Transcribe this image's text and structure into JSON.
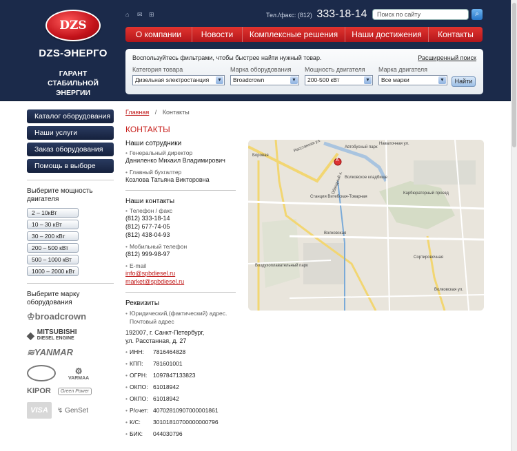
{
  "logo": {
    "mark": "DZS",
    "name": "DZS-ЭНЕРГО",
    "slogan_1": "ГАРАНТ СТАБИЛЬНОЙ",
    "slogan_2": "ЭНЕРГИИ"
  },
  "top_icons": [
    "home-icon",
    "mail-icon",
    "sitemap-icon"
  ],
  "phone": {
    "label": "Тел./факс: (812)",
    "number": "333-18-14"
  },
  "search": {
    "placeholder": "Поиск по сайту"
  },
  "nav": [
    "О компании",
    "Новости",
    "Комплексные решения",
    "Наши достижения",
    "Контакты"
  ],
  "filter": {
    "hint": "Воспользуйтесь фильтрами, чтобы быстрее найти нужный товар.",
    "advanced": "Расширенный поиск",
    "fields": [
      {
        "label": "Категория товара",
        "value": "Дизельная электростанция"
      },
      {
        "label": "Марка оборудования",
        "value": "Broadcrown"
      },
      {
        "label": "Мощность двигателя",
        "value": "200-500 кВт"
      },
      {
        "label": "Марка двигателя",
        "value": "Все марки"
      }
    ],
    "button": "Найти"
  },
  "sidebar": {
    "menu": [
      "Каталог оборудования",
      "Наши услуги",
      "Заказ оборудования",
      "Помощь в выборе"
    ],
    "power_title": "Выберите мощность двигателя",
    "power": [
      "2 – 10кВт",
      "10 – 30 кВт",
      "30 – 200 кВт",
      "200 – 500 кВт",
      "500 – 1000 кВт",
      "1000 – 2000 кВт"
    ],
    "brand_title": "Выберите марку оборудования",
    "brands": [
      "broadcrown",
      "MITSUBISHI",
      "DIESEL ENGINE",
      "YANMAR",
      "KIPOR",
      "Green Power",
      "VARMAA",
      "VISA",
      "GenSet"
    ]
  },
  "breadcrumb": {
    "home": "Главная",
    "separator": "/",
    "current": "Контакты"
  },
  "page_title": "КОНТАКТЫ",
  "staff": {
    "title": "Наши сотрудники",
    "items": [
      {
        "role": "Генеральный директор",
        "name": "Даниленко Михаил Владимирович"
      },
      {
        "role": "Главный бухгалтер",
        "name": "Козлова Татьяна Викторовна"
      }
    ]
  },
  "contacts": {
    "title": "Наши контакты",
    "phone_label": "Телефон / факс",
    "phones": [
      "(812) 333-18-14",
      "(812) 677-74-05",
      "(812) 438-04-93"
    ],
    "mobile_label": "Мобильный телефон",
    "mobile": "(812) 999-98-97",
    "email_label": "E-mail",
    "emails": [
      "info@spbdiesel.ru",
      "market@spbdiesel.ru"
    ]
  },
  "requisites": {
    "title": "Реквизиты",
    "address_label_1": "Юридический,(фактический) адрес.",
    "address_label_2": "Почтовый адрес",
    "address_1": "192007, г. Санкт-Петербург,",
    "address_2": "ул. Расстанная, д. 27",
    "rows": [
      {
        "key": "ИНН:",
        "value": "7816464828"
      },
      {
        "key": "КПП:",
        "value": "781601001"
      },
      {
        "key": "ОГРН:",
        "value": "1097847133823"
      },
      {
        "key": "ОКПО:",
        "value": "61018942"
      },
      {
        "key": "ОКПО:",
        "value": "61018942"
      },
      {
        "key": "Р/счет:",
        "value": "40702810907000001861"
      },
      {
        "key": "К/С:",
        "value": "30101810700000000796"
      },
      {
        "key": "БИК:",
        "value": "044030796"
      }
    ]
  },
  "map": {
    "labels": [
      "Боровая",
      "Расстанная ул.",
      "Обводный к.",
      "Навалочная ул.",
      "Волковское кладбище",
      "Станция Витебская-Товарная",
      "Волковская",
      "Воздухоплавательный парк",
      "Волковская ул.",
      "Сортировочная",
      "Карбюраторный проезд",
      "Автобусный парк"
    ],
    "marker": "A"
  }
}
